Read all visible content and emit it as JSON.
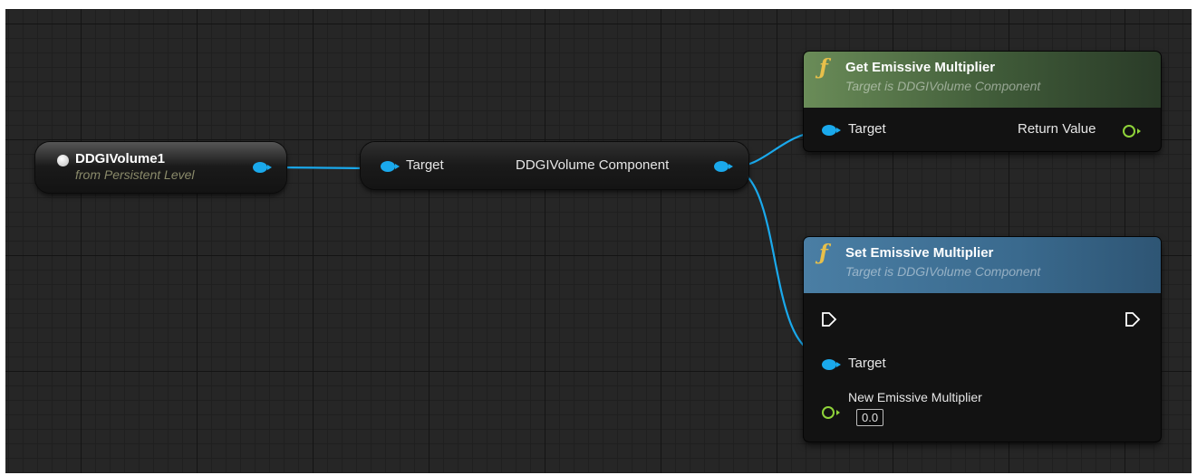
{
  "nodes": {
    "variable": {
      "title": "DDGIVolume1",
      "subtitle": "from Persistent Level"
    },
    "cast": {
      "input_label": "Target",
      "output_label": "DDGIVolume Component"
    },
    "get_fn": {
      "title": "Get Emissive Multiplier",
      "subtitle": "Target is DDGIVolume Component",
      "input_label": "Target",
      "output_label": "Return Value"
    },
    "set_fn": {
      "title": "Set Emissive Multiplier",
      "subtitle": "Target is DDGIVolume Component",
      "target_label": "Target",
      "param_label": "New Emissive Multiplier",
      "param_value": "0.0"
    }
  },
  "colors": {
    "object_pin": "#1aa9ec",
    "float_pin": "#8fd33a",
    "function_icon": "#e8c04a",
    "pure_header": "#6a8c58",
    "callable_header": "#4a7ea4"
  },
  "icons": [
    "function-icon",
    "exec-pin-icon",
    "object-pin-icon",
    "float-pin-icon"
  ]
}
